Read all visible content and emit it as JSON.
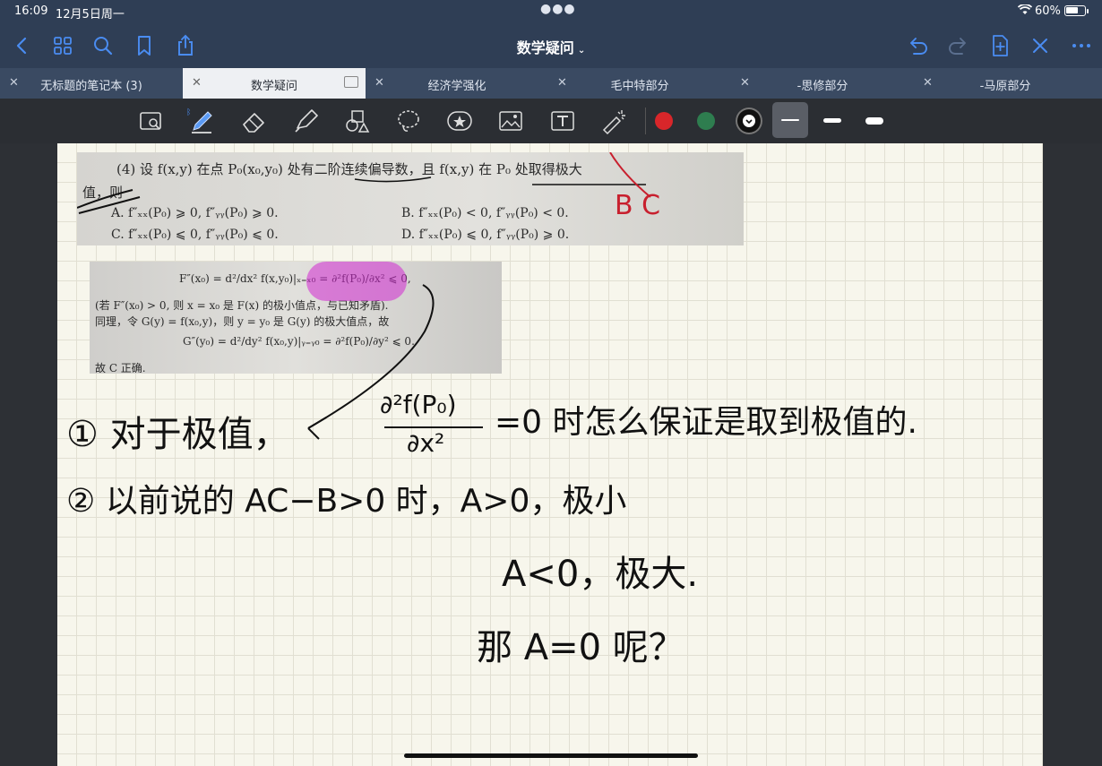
{
  "status": {
    "time": "16:09",
    "date": "12月5日周一",
    "battery": "60%",
    "battery_level": 0.6
  },
  "nav": {
    "title": "数学疑问",
    "icons": [
      "back-icon",
      "grid-icon",
      "search-icon",
      "bookmark-icon",
      "share-icon",
      "undo-icon",
      "redo-icon",
      "add-page-icon",
      "close-icon",
      "more-icon"
    ]
  },
  "tabs": [
    {
      "label": "无标题的笔记本 (3)",
      "active": false
    },
    {
      "label": "数学疑问",
      "active": true
    },
    {
      "label": "经济学强化",
      "active": false
    },
    {
      "label": "毛中特部分",
      "active": false
    },
    {
      "label": "-思修部分",
      "active": false
    },
    {
      "label": "-马原部分",
      "active": false
    }
  ],
  "toolbar": {
    "tools": [
      "lasso-zoom-icon",
      "pen-icon",
      "eraser-icon",
      "highlighter-icon",
      "shapes-icon",
      "lasso-icon",
      "sticker-icon",
      "image-icon",
      "text-icon",
      "laser-pointer-icon"
    ],
    "colors": [
      "#d8262a",
      "#2e7d4f",
      "#111111"
    ],
    "active_color": "#111111"
  },
  "photo1": {
    "q": "(4) 设 f(x,y) 在点 P₀(x₀,y₀) 处有二阶连续偏导数，且 f(x,y) 在 P₀ 处取得极大",
    "q2": "值，则",
    "a": "A. f″ₓₓ(P₀) ⩾ 0, f″ᵧᵧ(P₀) ⩾ 0.",
    "b": "B. f″ₓₓ(P₀) < 0, f″ᵧᵧ(P₀) < 0.",
    "c": "C. f″ₓₓ(P₀) ⩽ 0, f″ᵧᵧ(P₀) ⩽ 0.",
    "d": "D. f″ₓₓ(P₀) ⩽ 0, f″ᵧᵧ(P₀) ⩾ 0.",
    "ans": "B C"
  },
  "photo2": {
    "l1": "F″(x₀) = d²/dx² f(x,y₀)|ₓ₌ₓ₀ = ∂²f(P₀)/∂x² ⩽ 0,",
    "l2": "(若 F″(x₀) > 0, 则 x = x₀ 是 F(x) 的极小值点，与已知矛盾).",
    "l3": "同理，令 G(y) = f(x₀,y)，则 y = y₀ 是 G(y) 的极大值点，故",
    "l4": "G″(y₀) = d²/dy² f(x₀,y)|ᵧ₌ᵧ₀ = ∂²f(P₀)/∂y² ⩽ 0.",
    "l5": "故 C 正确."
  },
  "handwriting": {
    "line1a": "① 对于极值，",
    "frac_num": "∂²f(P₀)",
    "frac_den": "∂x²",
    "line1b": "=0 时怎么保证是取到极值的.",
    "line2": "② 以前说的 AC−B>0 时，A>0，极小",
    "line3": "A<0，极大.",
    "line4": "那 A=0 呢？"
  }
}
